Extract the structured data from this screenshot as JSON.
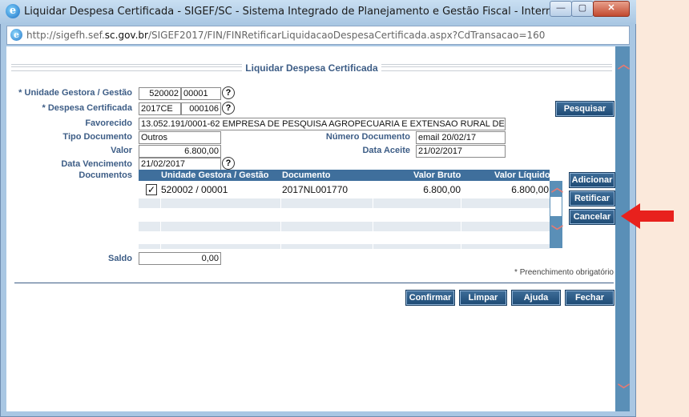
{
  "window": {
    "title": "Liquidar Despesa Certificada - SIGEF/SC - Sistema Integrado de Planejamento e Gestão Fiscal - Internet Explorer",
    "url_prefix": "http://sigefh.sef.",
    "url_domain": "sc.gov.br",
    "url_path": "/SIGEF2017/FIN/FINRetificarLiquidacaoDespesaCertificada.aspx?CdTransacao=160",
    "ie_icon_glyph": "e",
    "minimize_glyph": "—",
    "maximize_glyph": "▢",
    "close_glyph": "✕"
  },
  "page": {
    "heading": "Liquidar Despesa Certificada",
    "required_mark": "*",
    "labels": {
      "unidade_gestora": "Unidade Gestora / Gestão",
      "despesa_certificada": "Despesa Certificada",
      "favorecido": "Favorecido",
      "tipo_documento": "Tipo Documento",
      "numero_documento": "Número Documento",
      "valor": "Valor",
      "data_aceite": "Data Aceite",
      "data_vencimento": "Data Vencimento",
      "documentos": "Documentos",
      "saldo": "Saldo"
    },
    "values": {
      "unidade_gestora": "520002",
      "gestao": "00001",
      "despesa_ano": "2017CE",
      "despesa_numero": "000106",
      "favorecido": "13.052.191/0001-62 EMPRESA DE PESQUISA AGROPECUARIA E EXTENSAO RURAL DE SANTA CATA",
      "tipo_documento": "Outros",
      "numero_documento": "email 20/02/17",
      "valor": "6.800,00",
      "data_aceite": "21/02/2017",
      "data_vencimento": "21/02/2017",
      "saldo": "0,00"
    },
    "help_glyph": "?",
    "buttons": {
      "pesquisar": "Pesquisar",
      "adicionar": "Adicionar",
      "retificar": "Retificar",
      "cancelar": "Cancelar",
      "confirmar": "Confirmar",
      "limpar": "Limpar",
      "ajuda": "Ajuda",
      "fechar": "Fechar"
    },
    "grid": {
      "columns": [
        "Unidade Gestora / Gestão",
        "Documento",
        "Valor Bruto",
        "Valor Líquido"
      ],
      "rows": [
        {
          "checked": "✓",
          "unidade": "520002 / 00001",
          "documento": "2017NL001770",
          "valor_bruto": "6.800,00",
          "valor_liquido": "6.800,00"
        }
      ]
    },
    "footnote": "* Preenchimento obrigatório"
  },
  "colors": {
    "label": "#3d5d86",
    "button": "#1d4a74",
    "grid_header": "#3f6f9c",
    "arrow": "#e8211d"
  }
}
